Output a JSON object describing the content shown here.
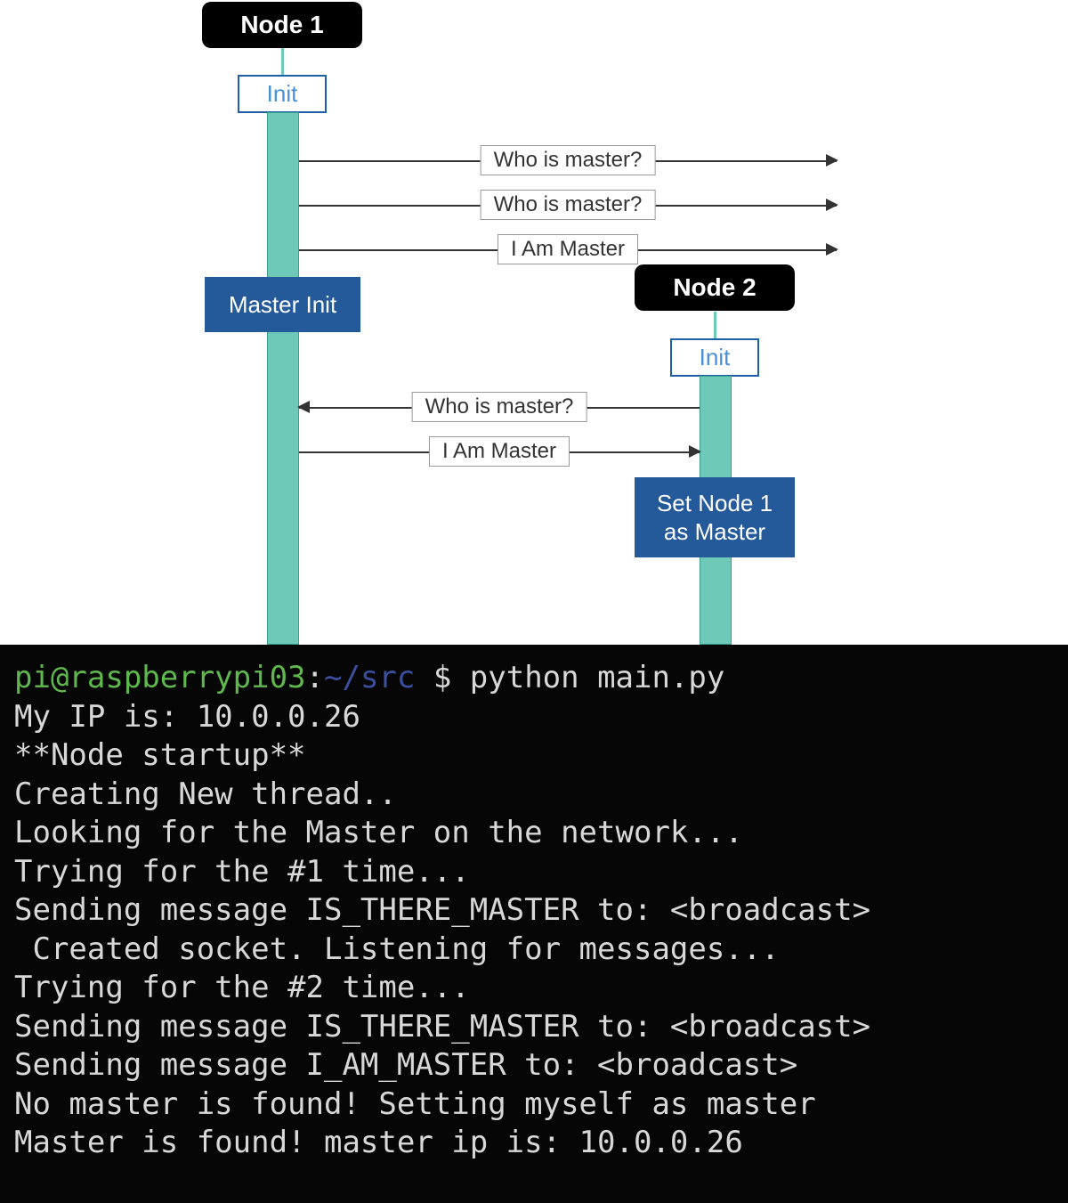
{
  "chart_data": {
    "type": "sequence-diagram",
    "nodes": [
      {
        "id": "node1",
        "label": "Node 1",
        "init_label": "Init",
        "action": "Master Init"
      },
      {
        "id": "node2",
        "label": "Node 2",
        "init_label": "Init",
        "action": "Set Node 1 as Master"
      }
    ],
    "messages": [
      {
        "from": "node1",
        "to": "broadcast",
        "text": "Who is master?"
      },
      {
        "from": "node1",
        "to": "broadcast",
        "text": "Who is master?"
      },
      {
        "from": "node1",
        "to": "broadcast",
        "text": "I Am Master"
      },
      {
        "from": "node2",
        "to": "node1",
        "text": "Who is master?"
      },
      {
        "from": "node1",
        "to": "node2",
        "text": "I Am Master"
      }
    ]
  },
  "diagram": {
    "node1_label": "Node 1",
    "node2_label": "Node 2",
    "init_label_1": "Init",
    "init_label_2": "Init",
    "master_init": "Master Init",
    "set_master": "Set Node 1\nas Master",
    "msg_who_1": "Who is master?",
    "msg_who_2": "Who is master?",
    "msg_iam_1": "I Am Master",
    "msg_who_3": "Who is master?",
    "msg_iam_2": "I Am Master"
  },
  "terminal": {
    "prompt_user": "pi@raspberrypi03",
    "prompt_sep1": ":",
    "prompt_path": "~/src",
    "prompt_sep2": " $ ",
    "command": "python main.py",
    "lines": [
      "My IP is: 10.0.0.26",
      "**Node startup**",
      "Creating New thread..",
      "Looking for the Master on the network...",
      "Trying for the #1 time...",
      "Sending message IS_THERE_MASTER to: <broadcast>",
      " Created socket. Listening for messages...",
      "Trying for the #2 time...",
      "Sending message IS_THERE_MASTER to: <broadcast>",
      "Sending message I_AM_MASTER to: <broadcast>",
      "No master is found! Setting myself as master",
      "Master is found! master ip is: 10.0.0.26"
    ]
  }
}
